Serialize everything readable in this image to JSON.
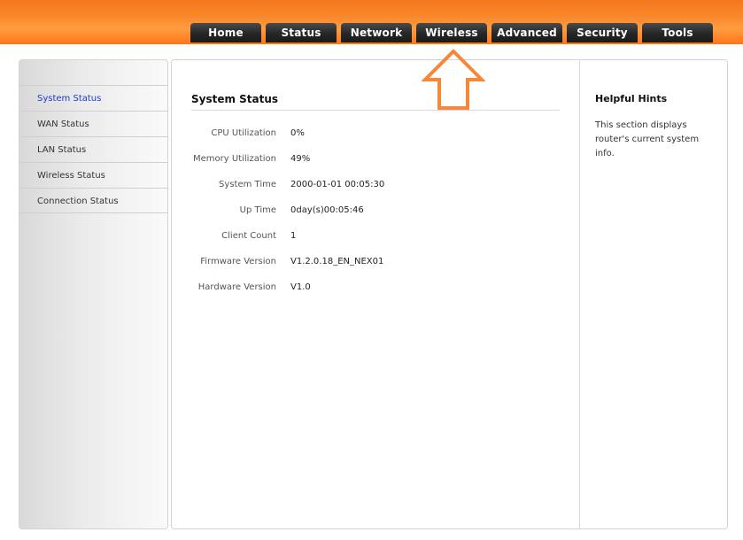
{
  "nav": {
    "tabs": [
      "Home",
      "Status",
      "Network",
      "Wireless",
      "Advanced",
      "Security",
      "Tools"
    ]
  },
  "sidebar": {
    "items": [
      "System Status",
      "WAN Status",
      "LAN Status",
      "Wireless Status",
      "Connection Status"
    ],
    "active_item": "System Status"
  },
  "main": {
    "title": "System Status",
    "rows": [
      {
        "label": "CPU Utilization",
        "value": "0%"
      },
      {
        "label": "Memory Utilization",
        "value": "49%"
      },
      {
        "label": "System Time",
        "value": "2000-01-01 00:05:30"
      },
      {
        "label": "Up Time",
        "value": "0day(s)00:05:46"
      },
      {
        "label": "Client Count",
        "value": "1"
      },
      {
        "label": "Firmware Version",
        "value": "V1.2.0.18_EN_NEX01"
      },
      {
        "label": "Hardware Version",
        "value": "V1.0"
      }
    ]
  },
  "hints": {
    "title": "Helpful Hints",
    "text": "This section displays router's current system info."
  },
  "annotation": {
    "icon": "up-arrow-icon",
    "points_to": "Wireless",
    "color": "#f5883a"
  },
  "colors": {
    "brand_orange": "#f9862a",
    "tab_dark": "#262626",
    "active_link": "#1a3cc8"
  }
}
